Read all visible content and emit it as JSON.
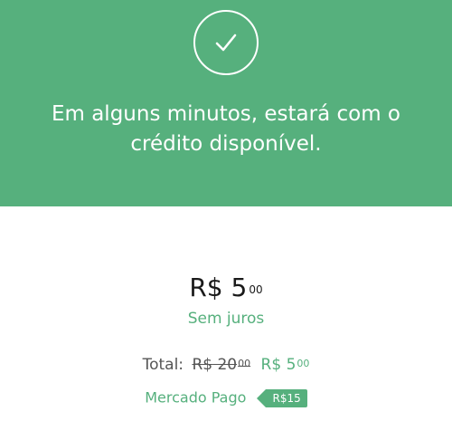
{
  "banner": {
    "icon": "checkmark-icon",
    "message_line1": "Em alguns minutos, estará com o",
    "message_line2": "crédito disponível.",
    "background_color": "#56b07d"
  },
  "price": {
    "currency": "R$",
    "amount": "5",
    "cents": "00"
  },
  "interest_label": "Sem juros",
  "total": {
    "label": "Total:",
    "old_currency": "R$",
    "old_amount": "20",
    "old_cents": "00",
    "new_currency": "R$",
    "new_amount": "5",
    "new_cents": "00"
  },
  "discount": {
    "provider": "Mercado Pago",
    "amount": "R$15"
  },
  "colors": {
    "accent": "#56b07d",
    "text_dark": "#1a1a1a",
    "text_muted": "#555555"
  }
}
